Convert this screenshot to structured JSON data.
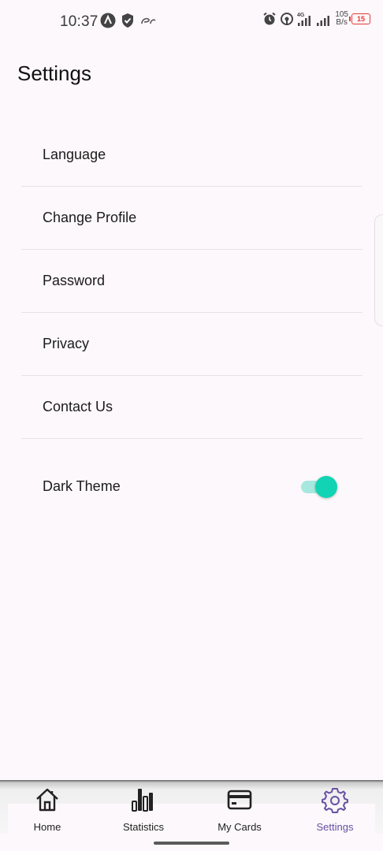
{
  "status_bar": {
    "time": "10:37",
    "network": "4G",
    "speed_value": "105",
    "speed_unit": "B/s",
    "battery": "15"
  },
  "header": {
    "title": "Settings"
  },
  "settings": {
    "items": [
      {
        "label": "Language"
      },
      {
        "label": "Change Profile"
      },
      {
        "label": "Password"
      },
      {
        "label": "Privacy"
      },
      {
        "label": "Contact Us"
      }
    ],
    "dark_theme": {
      "label": "Dark Theme",
      "enabled": true
    }
  },
  "bottom_nav": {
    "items": [
      {
        "label": "Home",
        "icon": "home-icon"
      },
      {
        "label": "Statistics",
        "icon": "bar-chart-icon"
      },
      {
        "label": "My Cards",
        "icon": "card-icon"
      },
      {
        "label": "Settings",
        "icon": "gear-icon"
      }
    ],
    "active": "Settings"
  },
  "colors": {
    "accent": "#6750a4",
    "toggle_on": "#12d3b4",
    "toggle_track": "#a7e8de",
    "background": "#fcf8fb"
  }
}
